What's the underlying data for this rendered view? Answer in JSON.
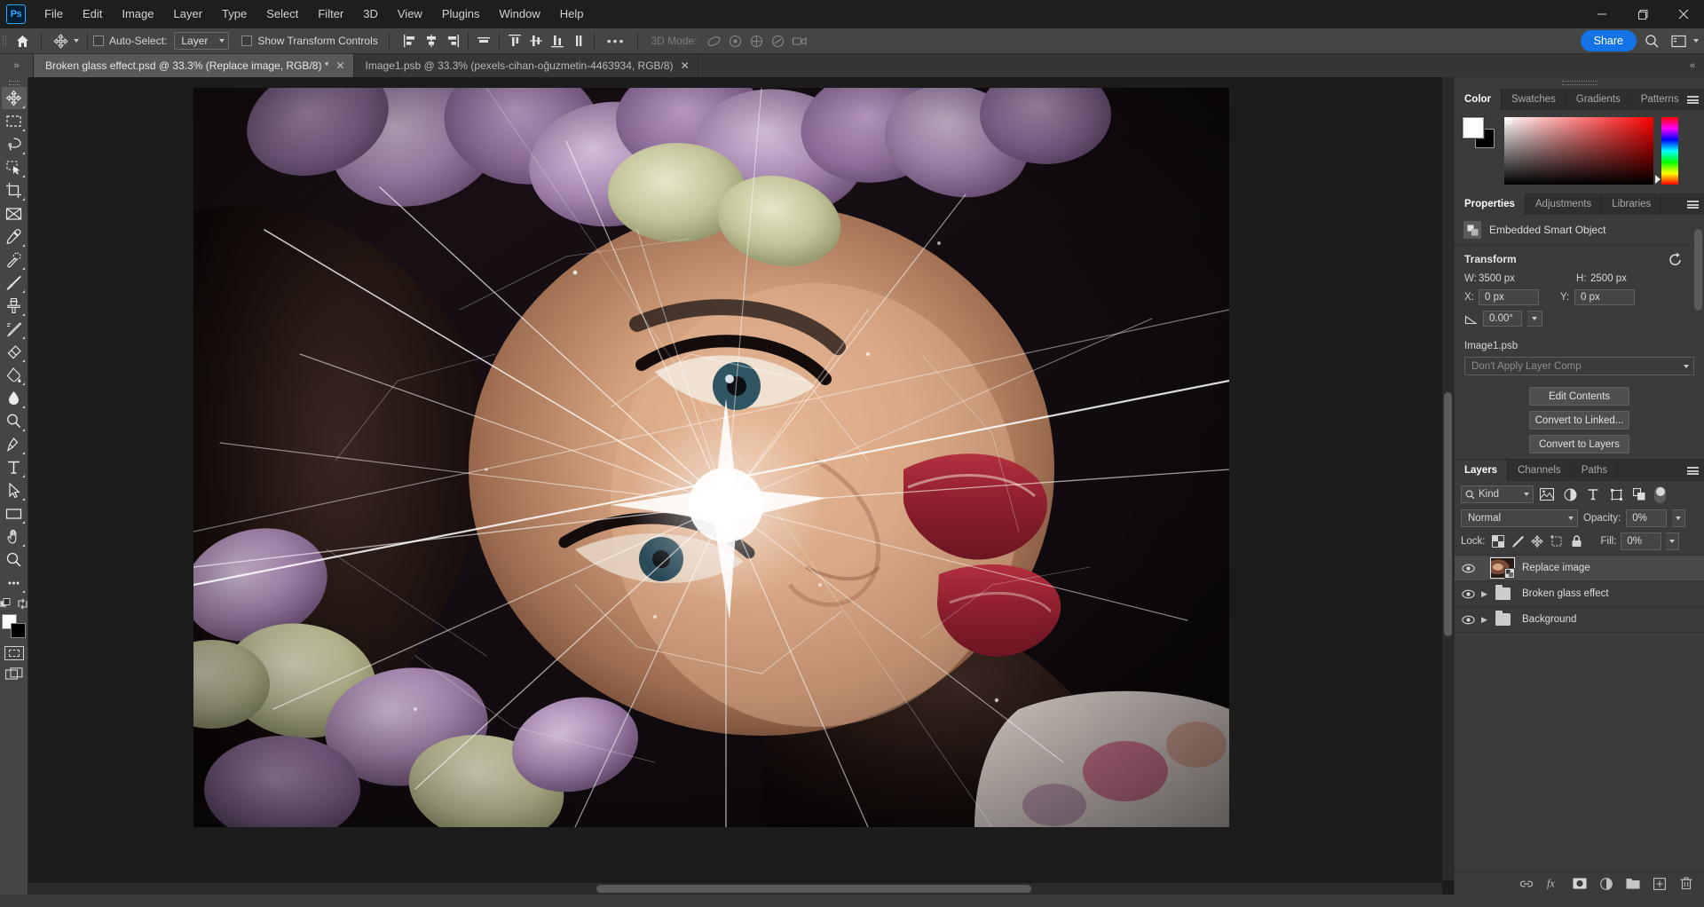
{
  "app": {
    "name": "Adobe Photoshop",
    "logo_text": "Ps"
  },
  "menubar": {
    "items": [
      "File",
      "Edit",
      "Image",
      "Layer",
      "Type",
      "Select",
      "Filter",
      "3D",
      "View",
      "Plugins",
      "Window",
      "Help"
    ]
  },
  "window_controls": {
    "minimize": "—",
    "maximize": "❐",
    "close": "✕"
  },
  "options_bar": {
    "home_icon": "home-icon",
    "tool_icon": "move-tool-icon",
    "auto_select_label": "Auto-Select:",
    "auto_select_checked": false,
    "layer_dropdown_value": "Layer",
    "show_transform_label": "Show Transform Controls",
    "show_transform_checked": false,
    "more_options": "•••",
    "mode_3d_label": "3D Mode:",
    "share_label": "Share"
  },
  "tabs": [
    {
      "label": "Broken glass effect.psd @ 33.3% (Replace image, RGB/8) *",
      "active": true,
      "closable": true
    },
    {
      "label": "Image1.psb @ 33.3% (pexels-cihan-oğuzmetin-4463934, RGB/8)",
      "active": false,
      "closable": true
    }
  ],
  "toolbar": {
    "tools": [
      {
        "name": "move-tool",
        "selected": true
      },
      {
        "name": "rectangular-marquee-tool",
        "selected": false
      },
      {
        "name": "lasso-tool",
        "selected": false
      },
      {
        "name": "object-selection-tool",
        "selected": false
      },
      {
        "name": "crop-tool",
        "selected": false
      },
      {
        "name": "frame-tool",
        "selected": false
      },
      {
        "name": "eyedropper-tool",
        "selected": false
      },
      {
        "name": "spot-healing-brush-tool",
        "selected": false
      },
      {
        "name": "brush-tool",
        "selected": false
      },
      {
        "name": "clone-stamp-tool",
        "selected": false
      },
      {
        "name": "history-brush-tool",
        "selected": false
      },
      {
        "name": "eraser-tool",
        "selected": false
      },
      {
        "name": "gradient-tool",
        "selected": false
      },
      {
        "name": "blur-tool",
        "selected": false
      },
      {
        "name": "dodge-tool",
        "selected": false
      },
      {
        "name": "pen-tool",
        "selected": false
      },
      {
        "name": "horizontal-type-tool",
        "selected": false
      },
      {
        "name": "path-selection-tool",
        "selected": false
      },
      {
        "name": "rectangle-tool",
        "selected": false
      },
      {
        "name": "hand-tool",
        "selected": false
      },
      {
        "name": "zoom-tool",
        "selected": false
      },
      {
        "name": "edit-toolbar-tool",
        "selected": false
      }
    ],
    "foreground_color": "#ffffff",
    "background_color": "#000000",
    "quick_mask_label": "quick-mask-icon",
    "screen_mode_label": "screen-mode-icon"
  },
  "color_panel": {
    "tabs": [
      {
        "label": "Color",
        "active": true
      },
      {
        "label": "Swatches",
        "active": false
      },
      {
        "label": "Gradients",
        "active": false
      },
      {
        "label": "Patterns",
        "active": false
      }
    ],
    "foreground": "#ffffff",
    "background": "#000000"
  },
  "properties_panel": {
    "tabs": [
      {
        "label": "Properties",
        "active": true
      },
      {
        "label": "Adjustments",
        "active": false
      },
      {
        "label": "Libraries",
        "active": false
      }
    ],
    "object_type": "Embedded Smart Object",
    "transform": {
      "title": "Transform",
      "w_label": "W:",
      "w_value": "3500 px",
      "h_label": "H:",
      "h_value": "2500 px",
      "x_label": "X:",
      "x_value": "0 px",
      "y_label": "Y:",
      "y_value": "0 px",
      "angle_value": "0.00°",
      "reset_icon": "reset-icon"
    },
    "file_name": "Image1.psb",
    "layer_comp_value": "Don't Apply Layer Comp",
    "buttons": [
      "Edit Contents",
      "Convert to Linked...",
      "Convert to Layers"
    ]
  },
  "layers_panel": {
    "tabs": [
      {
        "label": "Layers",
        "active": true
      },
      {
        "label": "Channels",
        "active": false
      },
      {
        "label": "Paths",
        "active": false
      }
    ],
    "filter_kind_label": "Kind",
    "filter_icons": [
      "pixel-filter-icon",
      "adjustment-filter-icon",
      "type-filter-icon",
      "shape-filter-icon",
      "smart-object-filter-icon"
    ],
    "blend_mode": "Normal",
    "opacity_label": "Opacity:",
    "opacity_value": "0%",
    "lock_label": "Lock:",
    "lock_icons": [
      "lock-transparent-pixels-icon",
      "lock-image-pixels-icon",
      "lock-position-icon",
      "lock-artboard-nesting-icon",
      "lock-all-icon"
    ],
    "fill_label": "Fill:",
    "fill_value": "0%",
    "layers": [
      {
        "name": "Replace image",
        "type": "smart-object",
        "visible": true,
        "selected": true,
        "expandable": false
      },
      {
        "name": "Broken glass effect",
        "type": "group",
        "visible": true,
        "selected": false,
        "expandable": true
      },
      {
        "name": "Background",
        "type": "group",
        "visible": true,
        "selected": false,
        "expandable": true
      }
    ],
    "footer_icons": [
      "link-layers-icon",
      "add-layer-style-icon",
      "add-layer-mask-icon",
      "new-fill-adjustment-icon",
      "new-group-icon",
      "new-layer-icon",
      "delete-layer-icon"
    ]
  },
  "canvas": {
    "document_title": "Broken glass effect.psd",
    "zoom": "33.3%",
    "image_description": "Portrait of a woman lying among purple and cream hydrangea flowers with a broken glass shatter overlay effect"
  }
}
